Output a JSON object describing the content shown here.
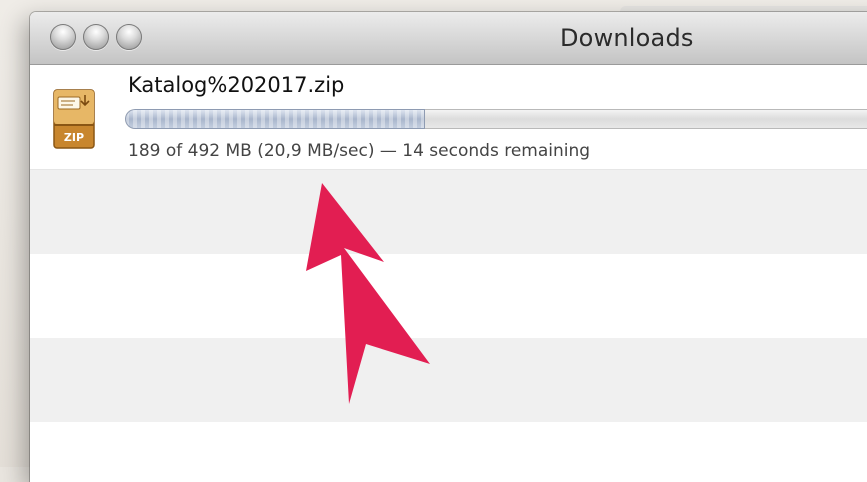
{
  "window": {
    "title": "Downloads"
  },
  "download": {
    "filename": "Katalog%202017.zip",
    "file_icon_label": "ZIP",
    "status": "189 of 492 MB (20,9 MB/sec) — 14 seconds remaining",
    "progress_fraction": 0.384
  },
  "colors": {
    "annotation_arrow": "#e21e52",
    "progress_fill": "#a9b6cc"
  },
  "icons": [
    "window-close-button",
    "window-minimize-button",
    "window-zoom-button",
    "zip-archive-icon",
    "annotation-arrow"
  ]
}
